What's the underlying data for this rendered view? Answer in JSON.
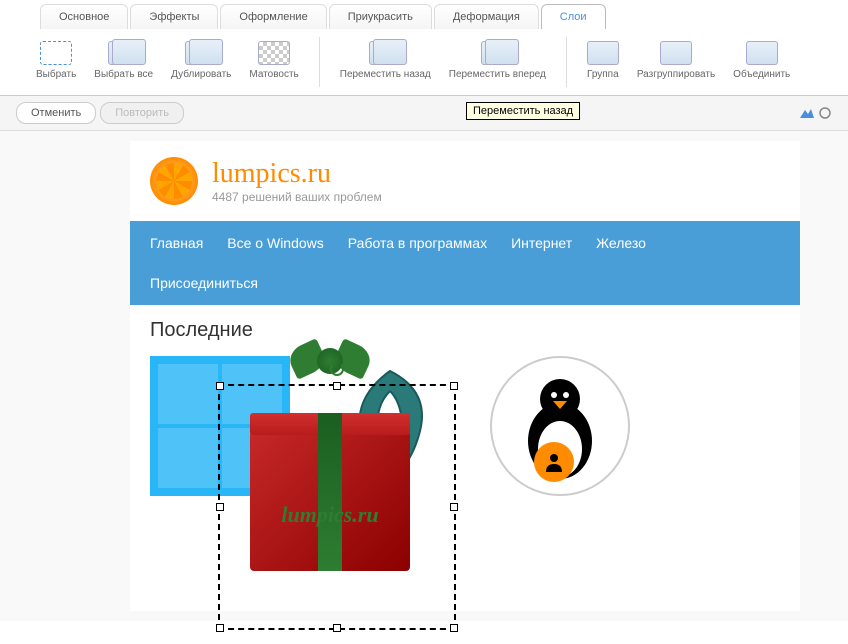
{
  "tabs": {
    "t0": "Основное",
    "t1": "Эффекты",
    "t2": "Оформление",
    "t3": "Приукрасить",
    "t4": "Деформация",
    "t5": "Слои"
  },
  "ribbon": {
    "select": "Выбрать",
    "select_all": "Выбрать все",
    "duplicate": "Дублировать",
    "opacity": "Матовость",
    "move_back": "Переместить назад",
    "move_fwd": "Переместить вперед",
    "group": "Группа",
    "ungroup": "Разгруппировать",
    "merge": "Объединить"
  },
  "tooltip": "Переместить назад",
  "history": {
    "undo": "Отменить",
    "redo": "Повторить"
  },
  "site": {
    "title": "lumpics.ru",
    "subtitle": "4487 решений ваших проблем"
  },
  "nav": {
    "home": "Главная",
    "windows": "Все о Windows",
    "programs": "Работа в программах",
    "internet": "Интернет",
    "hardware": "Железо",
    "join": "Присоединиться"
  },
  "section": "Последние",
  "watermark": "lumpics.ru"
}
